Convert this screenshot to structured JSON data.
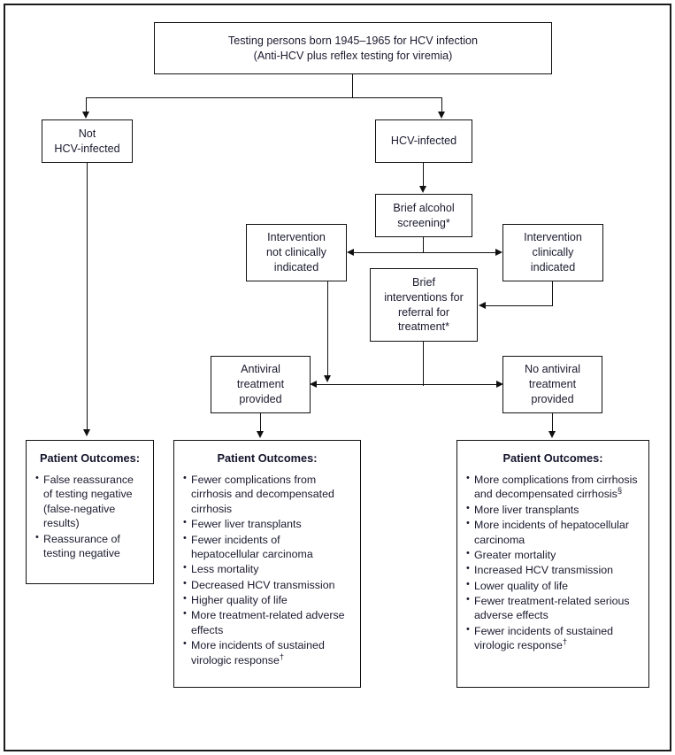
{
  "figure": {
    "type": "flowchart",
    "subject": "HCV testing and treatment decision pathway"
  },
  "nodes": {
    "testing": {
      "line1": "Testing persons born 1945–1965 for HCV infection",
      "line2": "(Anti-HCV plus reflex testing for viremia)"
    },
    "not_infected": {
      "line1": "Not",
      "line2": "HCV-infected"
    },
    "infected": {
      "line1": "HCV-infected"
    },
    "alcohol_screening": {
      "line1": "Brief alcohol",
      "line2": "screening*"
    },
    "not_indicated": {
      "line1": "Intervention",
      "line2": "not clinically",
      "line3": "indicated"
    },
    "clinically_indicated": {
      "line1": "Intervention",
      "line2": "clinically",
      "line3": "indicated"
    },
    "brief_interventions": {
      "line1": "Brief",
      "line2": "interventions for",
      "line3": "referral for",
      "line4": "treatment*"
    },
    "antiviral": {
      "line1": "Antiviral",
      "line2": "treatment",
      "line3": "provided"
    },
    "no_antiviral": {
      "line1": "No antiviral",
      "line2": "treatment",
      "line3": "provided"
    }
  },
  "outcomes": {
    "left": {
      "title": "Patient Outcomes:",
      "items": [
        "False reassurance of testing negative (false-negative results)",
        "Reassurance of testing negative"
      ]
    },
    "middle": {
      "title": "Patient Outcomes:",
      "items": [
        "Fewer complications from cirrhosis and decompensated cirrhosis",
        "Fewer liver transplants",
        "Fewer incidents of hepatocellular carcinoma",
        "Less mortality",
        "Decreased HCV transmission",
        "Higher quality of life",
        "More treatment-related adverse effects",
        "More incidents of sustained virologic response†"
      ]
    },
    "right": {
      "title": "Patient Outcomes:",
      "items": [
        "More complications from cirrhosis and decompensated cirrhosis§",
        "More liver transplants",
        "More incidents of hepatocellular carcinoma",
        "Greater mortality",
        "Increased HCV transmission",
        "Lower quality of life",
        "Fewer treatment-related serious adverse effects",
        "Fewer incidents of sustained virologic response†"
      ]
    }
  },
  "colors": {
    "line": "#101010",
    "text": "#1a1a2e",
    "background": "#ffffff"
  }
}
